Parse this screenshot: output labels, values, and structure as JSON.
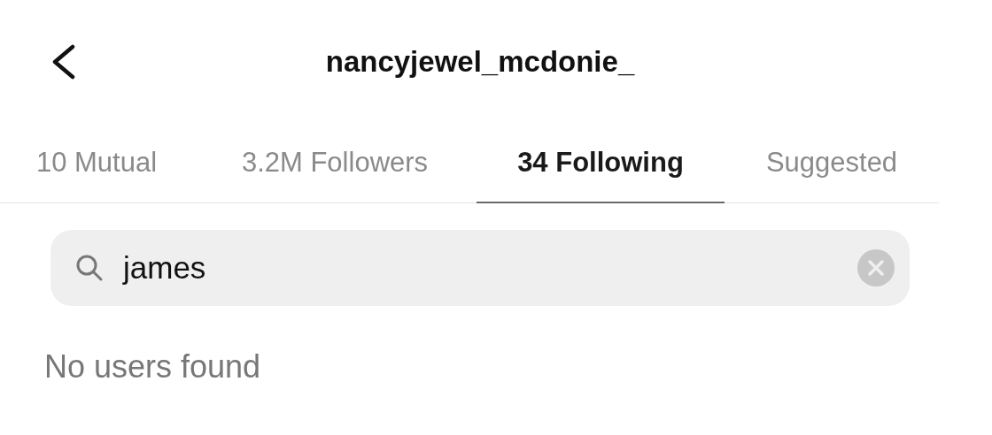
{
  "header": {
    "title": "nancyjewel_mcdonie_"
  },
  "tabs": [
    {
      "label": "10 Mutual",
      "selected": false
    },
    {
      "label": "3.2M Followers",
      "selected": false
    },
    {
      "label": "34 Following",
      "selected": true
    },
    {
      "label": "Suggested",
      "selected": false
    }
  ],
  "search": {
    "value": "james"
  },
  "message": "No users found"
}
